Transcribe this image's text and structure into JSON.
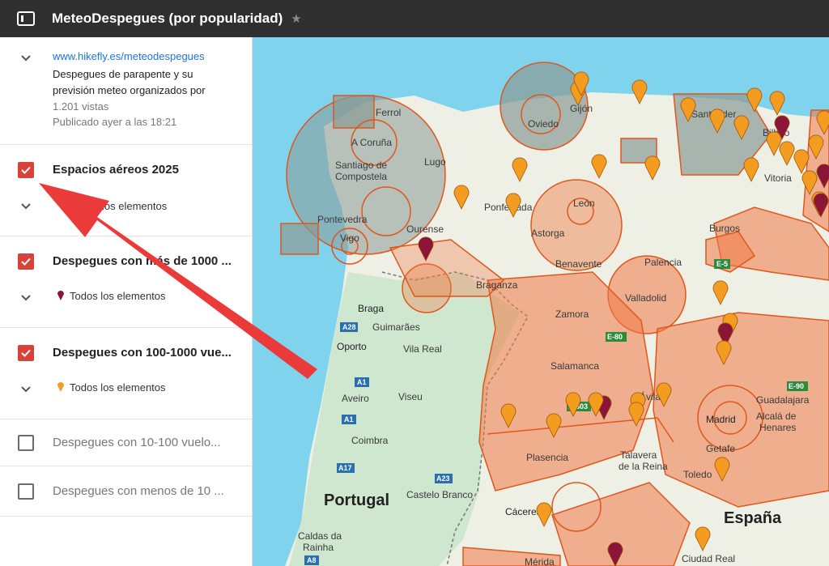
{
  "header": {
    "title": "MeteoDespegues (por popularidad)",
    "toggle_icon": "panel-toggle-icon",
    "star_icon": "star-icon"
  },
  "info": {
    "link": "www.hikefly.es/meteodespegues",
    "description": "Despegues de parapente y su previsión meteo organizados por",
    "views": "1.201 vistas",
    "published": "Publicado ayer a las 18:21"
  },
  "layers": [
    {
      "title": "Espacios aéreos 2025",
      "checked": true,
      "sub": "los elementos"
    },
    {
      "title": "Despegues con más de 1000 ...",
      "checked": true,
      "sub": "Todos los elementos",
      "pin_color": "#8b1538"
    },
    {
      "title": "Despegues con 100-1000 vue...",
      "checked": true,
      "sub": "Todos los elementos",
      "pin_color": "#f39c1f"
    },
    {
      "title": "Despegues con 10-100 vuelo...",
      "checked": false
    },
    {
      "title": "Despegues con menos de 10 ...",
      "checked": false
    }
  ],
  "map": {
    "towns": [
      "Ferrol",
      "A Coruña",
      "Lugo",
      "Santiago de",
      "Compostela",
      "Pontevedra",
      "Vigo",
      "Ourense",
      "Gijón",
      "Oviedo",
      "Santander",
      "Bilbao",
      "Vitoria",
      "Ponferrada",
      "León",
      "Astorga",
      "Burgos",
      "Benavente",
      "Palencia",
      "Valladolid",
      "Braganza",
      "Braga",
      "Guimarães",
      "Oporto",
      "Vila Real",
      "Zamora",
      "Salamanca",
      "Aveiro",
      "Viseu",
      "Ávila",
      "Madrid",
      "Guadalajara",
      "Alcalá de",
      "Henares",
      "Getafe",
      "Coimbra",
      "Plasencia",
      "Talavera",
      "de la Reina",
      "Toledo",
      "Castelo Branco",
      "Cáceres",
      "Caldas da",
      "Rainha",
      "Mérida",
      "Ciudad Real"
    ],
    "countries": [
      "Portugal",
      "España"
    ],
    "roads": [
      "A28",
      "A1",
      "A17",
      "A23",
      "A8",
      "E-80",
      "E-803",
      "E-90",
      "E-5",
      "A1"
    ],
    "colors": {
      "sea": "#7fd3ec",
      "land": "#eef0e6",
      "green_land": "#cfe6cf",
      "airspace_fill": "#f07a45",
      "airspace_stroke": "#e0561b",
      "airspace_grey": "#8a9a96",
      "pin_orange": "#f39c1f",
      "pin_maroon": "#8b1538",
      "arrow": "#ea3a3a"
    }
  }
}
